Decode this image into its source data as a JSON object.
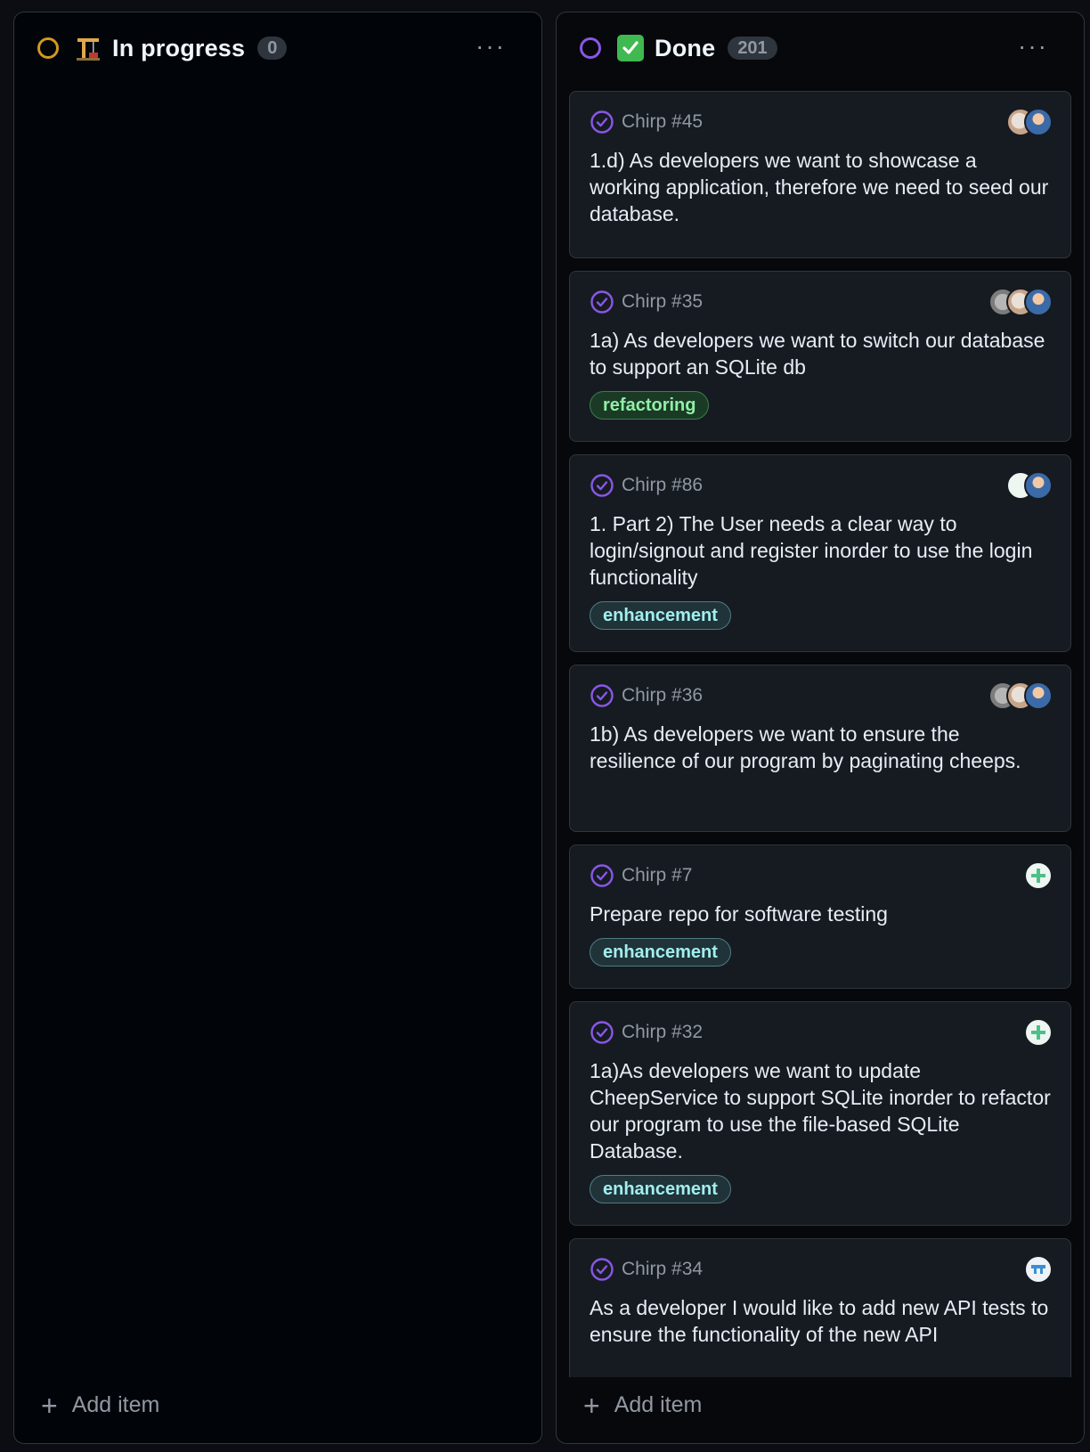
{
  "columns": [
    {
      "title": "In progress",
      "count": "0",
      "emoji": "construction-crane",
      "ring_color": "#d29922",
      "add_label": "Add item",
      "cards": []
    },
    {
      "title": "Done",
      "count": "201",
      "emoji": "check-mark-button",
      "ring_color": "#8957e5",
      "add_label": "Add item",
      "cards": [
        {
          "ref": "Chirp #45",
          "title": "1.d) As developers we want to showcase a working application, therefore we need to seed our database.",
          "label": "",
          "assignees": [
            "avatar-light",
            "avatar-blue"
          ]
        },
        {
          "ref": "Chirp #35",
          "title": "1a) As developers we want to switch our database to support an SQLite db",
          "label": "refactoring",
          "assignees": [
            "avatar-grey",
            "avatar-light",
            "avatar-blue"
          ]
        },
        {
          "ref": "Chirp #86",
          "title": "1. Part 2) The User needs a clear way to login/signout and register inorder to use the login functionality",
          "label": "enhancement",
          "assignees": [
            "avatar-green",
            "avatar-blue"
          ]
        },
        {
          "ref": "Chirp #36",
          "title": "1b) As developers we want to ensure the resilience of our program by paginating cheeps.",
          "label": "",
          "assignees": [
            "avatar-grey",
            "avatar-light",
            "avatar-blue"
          ]
        },
        {
          "ref": "Chirp #7",
          "title": "Prepare repo for software testing",
          "label": "enhancement",
          "assignees": [
            "avatar-green"
          ]
        },
        {
          "ref": "Chirp #32",
          "title": "1a)As developers we want to update CheepService to support SQLite inorder to refactor our program to use the file-based SQLite Database.",
          "label": "enhancement",
          "assignees": [
            "avatar-green"
          ]
        },
        {
          "ref": "Chirp #34",
          "title": "As a developer I would like to add new API tests to ensure the functionality of the new API",
          "label": "",
          "assignees": [
            "avatar-teal"
          ]
        }
      ]
    }
  ],
  "colors": {
    "background": "#010409",
    "card_background": "#161b22",
    "issue_closed": "#8957e5",
    "label_refactoring": "#8ff0a4",
    "label_enhancement": "#a2eeef"
  }
}
